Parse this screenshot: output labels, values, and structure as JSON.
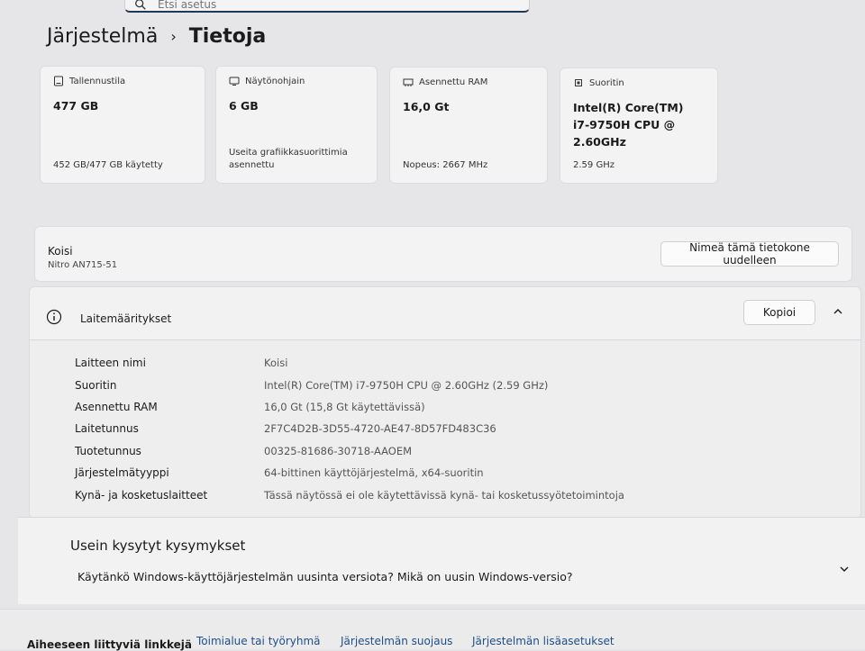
{
  "search": {
    "placeholder": "Etsi asetus"
  },
  "breadcrumb": {
    "parent": "Järjestelmä",
    "separator": "›",
    "current": "Tietoja"
  },
  "cards": [
    {
      "label": "Tallennustila",
      "value": "477 GB",
      "sub": "452 GB/477 GB käytetty",
      "icon": "storage-icon"
    },
    {
      "label": "Näytönohjain",
      "value": "6 GB",
      "sub": "Useita grafiikkasuorittimia asennettu",
      "icon": "gpu-icon"
    },
    {
      "label": "Asennettu RAM",
      "value": "16,0 Gt",
      "sub": "Nopeus: 2667 MHz",
      "icon": "ram-icon"
    },
    {
      "label": "Suoritin",
      "value": "Intel(R) Core(TM) i7-9750H CPU @ 2.60GHz",
      "sub": "2.59 GHz",
      "icon": "cpu-icon"
    }
  ],
  "device": {
    "name": "Koisi",
    "model": "Nitro AN715-51",
    "rename_button": "Nimeä tämä tietokone uudelleen"
  },
  "specs": {
    "title": "Laitemääritykset",
    "copy_button": "Kopioi",
    "rows": [
      {
        "k": "Laitteen nimi",
        "v": "Koisi"
      },
      {
        "k": "Suoritin",
        "v": "Intel(R) Core(TM) i7-9750H CPU @ 2.60GHz (2.59 GHz)"
      },
      {
        "k": "Asennettu RAM",
        "v": "16,0 Gt (15,8 Gt käytettävissä)"
      },
      {
        "k": "Laitetunnus",
        "v": "2F7C4D2B-3D55-4720-AE47-8D57FD483C36"
      },
      {
        "k": "Tuotetunnus",
        "v": "00325-81686-30718-AAOEM"
      },
      {
        "k": "Järjestelmätyyppi",
        "v": "64-bittinen käyttöjärjestelmä, x64-suoritin"
      },
      {
        "k": "Kynä- ja kosketuslaitteet",
        "v": "Tässä näytössä ei ole käytettävissä kynä- tai kosketussyötetoimintoja"
      }
    ]
  },
  "faq": {
    "title": "Usein kysytyt kysymykset",
    "question": "Käytänkö Windows-käyttöjärjestelmän uusinta versiota? Mikä on uusin Windows-versio?"
  },
  "related": {
    "label": "Aiheeseen liittyviä linkkejä",
    "links": [
      "Toimialue tai työryhmä",
      "Järjestelmän suojaus",
      "Järjestelmän lisäasetukset"
    ]
  },
  "colors": {
    "accent": "#1f3a57",
    "link": "#1f4e8a",
    "background": "#e6e6e8"
  }
}
